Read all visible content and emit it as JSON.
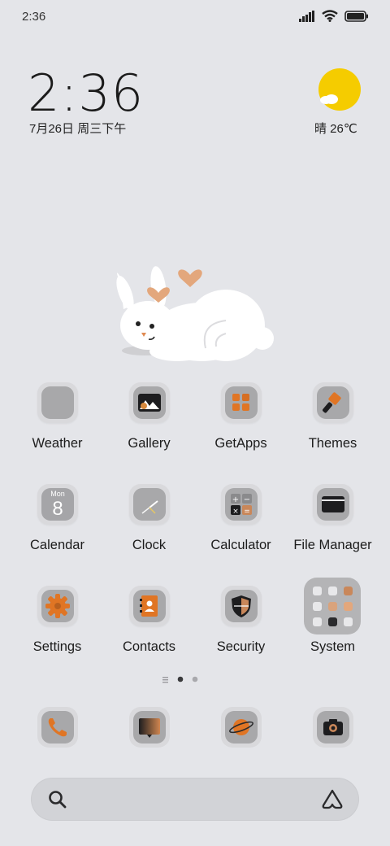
{
  "status_bar": {
    "time": "2:36"
  },
  "clock_widget": {
    "time": "2:36",
    "date": "7月26日 周三下午"
  },
  "weather_widget": {
    "text": "晴 26℃"
  },
  "apps_row1": [
    {
      "label": "Weather"
    },
    {
      "label": "Gallery"
    },
    {
      "label": "GetApps"
    },
    {
      "label": "Themes"
    }
  ],
  "apps_row2": [
    {
      "label": "Calendar",
      "icon_text": "Mon",
      "icon_number": "8"
    },
    {
      "label": "Clock"
    },
    {
      "label": "Calculator"
    },
    {
      "label": "File Manager"
    }
  ],
  "apps_row3": [
    {
      "label": "Settings"
    },
    {
      "label": "Contacts"
    },
    {
      "label": "Security"
    },
    {
      "label": "System"
    }
  ],
  "page_indicator": {
    "pages": 2,
    "current": 1
  },
  "dock": [
    "phone-icon",
    "messages-icon",
    "browser-icon",
    "camera-icon"
  ],
  "colors": {
    "accent": "#e07524",
    "background": "#e4e5e9",
    "sun": "#f5cc00",
    "icon_gray": "#a8a8aa"
  }
}
